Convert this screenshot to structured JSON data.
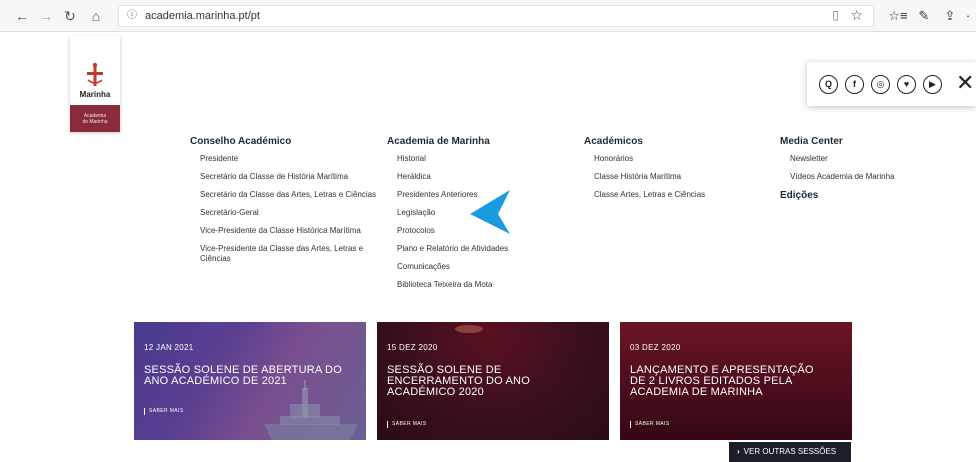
{
  "browser": {
    "url": "academia.marinha.pt/pt",
    "back_glyph": "←",
    "forward_glyph": "→",
    "refresh_glyph": "↻",
    "home_glyph": "⌂",
    "info_glyph": "ⓘ",
    "reader_glyph": "▯",
    "favorite_glyph": "☆",
    "favorites_bar_glyph": "☆≡",
    "notes_glyph": "✎",
    "share_glyph": "⇪",
    "more_glyph": "·"
  },
  "logo": {
    "brand": "Marinha",
    "subtitle_line1": "Academia",
    "subtitle_line2": "de Marinha"
  },
  "social": {
    "icons": [
      "search-icon",
      "facebook-icon",
      "instagram-icon",
      "twitter-icon",
      "youtube-icon"
    ],
    "glyphs": [
      "Q",
      "f",
      "◎",
      "♥",
      "▶"
    ],
    "close_glyph": "✕"
  },
  "menu": {
    "col1": {
      "title": "Conselho Académico",
      "items": [
        "Presidente",
        "Secretário da Classe de História Marítima",
        "Secretário da Classe das Artes, Letras e Ciências",
        "Secretário-Geral",
        "Vice-Presidente da Classe Histórica Marítima",
        "Vice-Presidente da Classe das Artes, Letras e Ciências"
      ]
    },
    "col2": {
      "title": "Academia de Marinha",
      "items": [
        "Historial",
        "Heráldica",
        "Presidentes Anteriores",
        "Legislação",
        "Protocolos",
        "Plano e Relatório de Atividades",
        "Comunicações",
        "Biblioteca Teixeira da Mota"
      ]
    },
    "col3": {
      "title": "Académicos",
      "items": [
        "Honorários",
        "Classe História Marítima",
        "Classe Artes, Letras e Ciências"
      ]
    },
    "col4": {
      "title": "Media Center",
      "items": [
        "Newsletter",
        "Vídeos Academia de Marinha"
      ],
      "extra_title": "Edições"
    }
  },
  "news": [
    {
      "date": "12 JAN 2021",
      "title": "SESSÃO SOLENE DE ABERTURA DO ANO ACADÉMICO DE 2021",
      "more": "SABER MAIS"
    },
    {
      "date": "15 DEZ 2020",
      "title": "SESSÃO SOLENE DE ENCERRAMENTO DO ANO ACADÉMICO 2020",
      "more": "SABER MAIS"
    },
    {
      "date": "03 DEZ 2020",
      "title": "LANÇAMENTO E APRESENTAÇÃO DE 2 LIVROS EDITADOS PELA ACADEMIA DE MARINHA",
      "more": "SABER MAIS"
    }
  ],
  "more_sessions": {
    "chevron": "›",
    "label": "VER OUTRAS SESSÕES"
  },
  "colors": {
    "logo_band": "#8a2b3b",
    "pointer": "#1a9be0",
    "button_dark": "#1c1f2a"
  }
}
